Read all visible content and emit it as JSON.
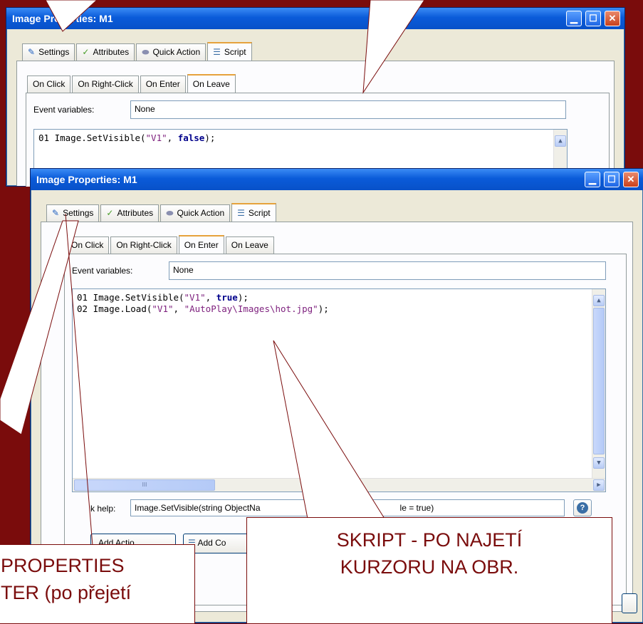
{
  "back_window": {
    "title": "Image Properties: M1",
    "tabs": [
      "Settings",
      "Attributes",
      "Quick Action",
      "Script"
    ],
    "event_tabs": [
      "On Click",
      "On Right-Click",
      "On Enter",
      "On Leave"
    ],
    "event_variables_label": "Event variables:",
    "event_variables_value": "None",
    "code_lines": [
      {
        "num": "01",
        "pre": "Image.SetVisible(",
        "str1": "\"V1\"",
        "mid": ", ",
        "kw": "false",
        "post": ");"
      }
    ]
  },
  "front_window": {
    "title": "Image Properties: M1",
    "tabs": [
      "Settings",
      "Attributes",
      "Quick Action",
      "Script"
    ],
    "event_tabs": [
      "On Click",
      "On Right-Click",
      "On Enter",
      "On Leave"
    ],
    "event_variables_label": "Event variables:",
    "event_variables_value": "None",
    "code_lines": [
      {
        "num": "01",
        "pre": "Image.SetVisible(",
        "str1": "\"V1\"",
        "mid": ", ",
        "kw": "true",
        "post": ");"
      },
      {
        "num": "02",
        "pre": "Image.Load(",
        "str1": "\"V1\"",
        "mid": ", ",
        "str2": "\"AutoPlay\\Images\\hot.jpg\"",
        "post": ");"
      }
    ],
    "hscroll_mark": "III",
    "quick_help_label": "k help:",
    "quick_help_value_a": "Image.SetVisible(string ObjectNa",
    "quick_help_value_b": "le = true)",
    "add_action_label": "Add Actio",
    "add_code_label": "Add Co"
  },
  "callouts": {
    "left_line1": "PROPERTIES",
    "left_line2": "TER (po přejetí",
    "right_line1": "SKRIPT - PO NAJETÍ",
    "right_line2": "KURZORU NA OBR."
  },
  "colors": {
    "background": "#7a0c0c",
    "xp_title_blue": "#0a5bd9",
    "callout_text": "#7a0c0c"
  }
}
